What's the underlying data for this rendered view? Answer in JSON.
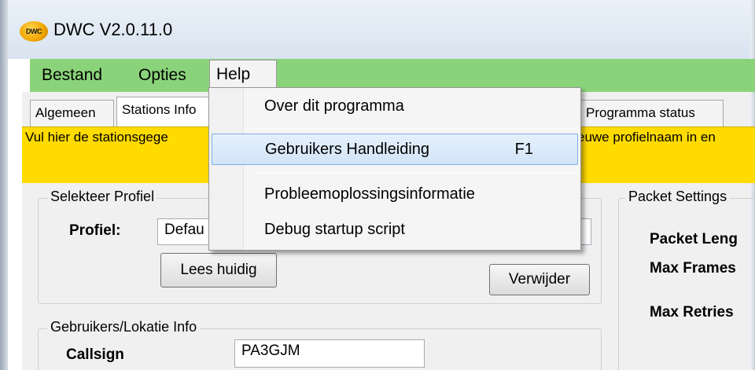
{
  "window": {
    "logo_text": "DWC",
    "title": "DWC V2.0.11.0"
  },
  "menubar": {
    "items": [
      "Bestand",
      "Opties",
      "Help"
    ]
  },
  "tabs": [
    "Algemeen",
    "Stations Info",
    "Programma status"
  ],
  "notice": {
    "text_left": "Vul hier de stationsgege",
    "text_right": "euwe profielnaam in en"
  },
  "profile": {
    "group_title": "Selekteer Profiel",
    "label": "Profiel:",
    "value": "Defau",
    "read_button": "Lees huidig",
    "delete_button": "Verwijder"
  },
  "user_info": {
    "group_title": "Gebruikers/Lokatie Info",
    "callsign_label": "Callsign",
    "callsign_value": "PA3GJM"
  },
  "packet": {
    "group_title": "Packet Settings",
    "labels": [
      "Packet Leng",
      "Max Frames",
      "Max Retries"
    ]
  },
  "help_menu": {
    "items": [
      {
        "label": "Over dit programma",
        "shortcut": ""
      },
      {
        "label": "Gebruikers Handleiding",
        "shortcut": "F1"
      },
      {
        "label": "Probleemoplossingsinformatie",
        "shortcut": ""
      },
      {
        "label": "Debug startup script",
        "shortcut": ""
      }
    ]
  },
  "colors": {
    "menubar": "#8ad37a",
    "notice": "#ffdb00",
    "highlight_border": "#7eaee3"
  }
}
